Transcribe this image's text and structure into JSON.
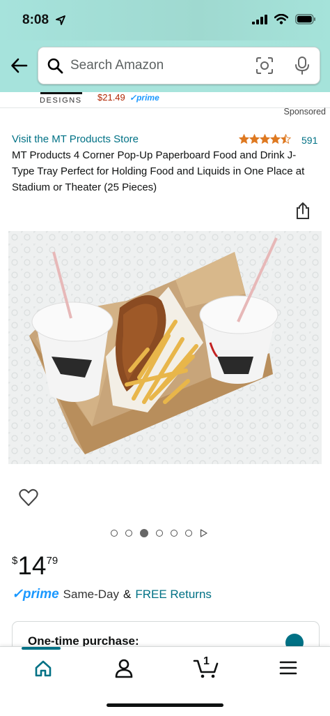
{
  "status_bar": {
    "time": "8:08"
  },
  "search": {
    "placeholder": "Search Amazon"
  },
  "banner": {
    "designs_label": "DESIGNS",
    "price": "$21.49",
    "prime_label": "prime"
  },
  "sponsored_label": "Sponsored",
  "product": {
    "store_link": "Visit the MT Products Store",
    "rating": 4.5,
    "rating_count": "591",
    "title": "MT Products 4 Corner Pop-Up Paperboard Food and Drink J-Type Tray Perfect for Holding Food and Liquids in One Place at Stadium or Theater (25 Pieces)",
    "image_count": 6,
    "active_image_index": 2,
    "price": {
      "currency": "$",
      "whole": "14",
      "fraction": "79"
    },
    "prime_label": "prime",
    "same_day_label": "Same-Day",
    "and_label": "&",
    "free_returns_label": "FREE Returns"
  },
  "purchase_card": {
    "title": "One-time purchase:"
  },
  "bottom_nav": {
    "cart_count": "1",
    "items": [
      "home-icon",
      "account-icon",
      "cart-icon",
      "menu-icon"
    ]
  },
  "colors": {
    "header_bg": "#a6e3dc",
    "link": "#007185",
    "prime_blue": "#1a98ff",
    "star": "#de7921",
    "price_red": "#b12704"
  }
}
